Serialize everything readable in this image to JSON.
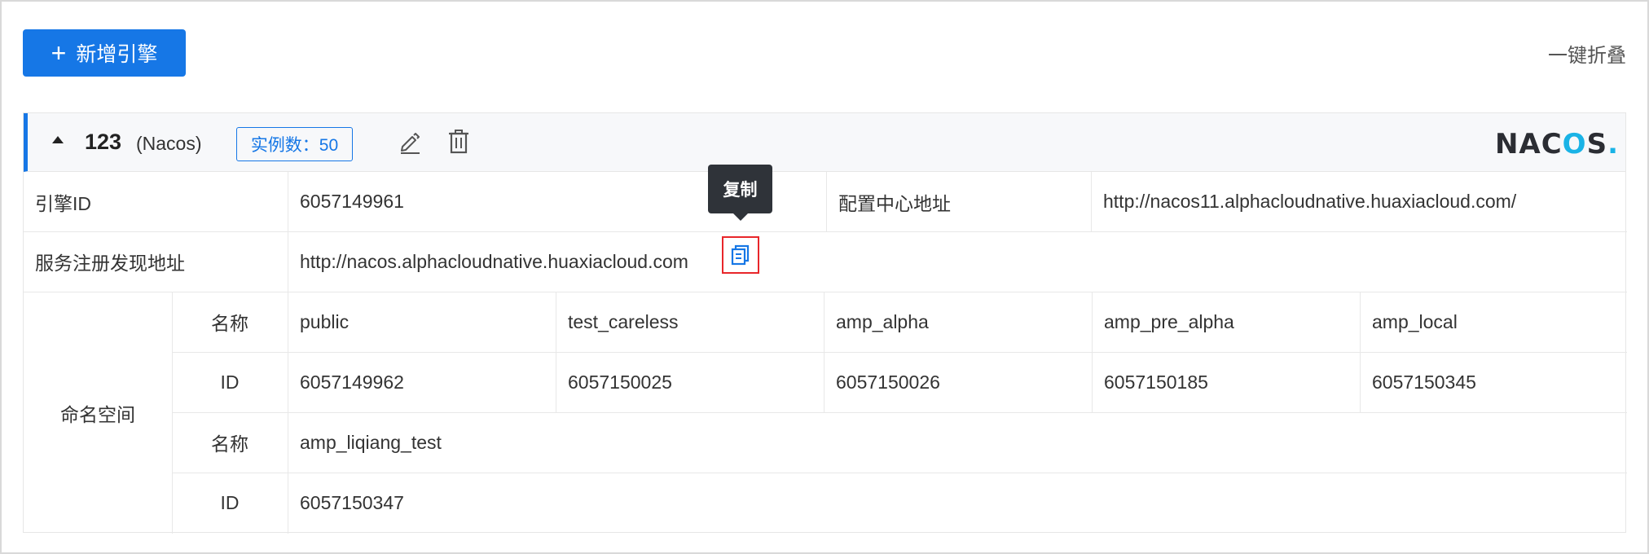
{
  "toolbar": {
    "add_label": "新增引擎",
    "collapse_all_label": "一键折叠"
  },
  "engine": {
    "name": "123",
    "type": "(Nacos)",
    "instance_badge": "实例数：50",
    "logo_text_pre": "NAC",
    "logo_text_o": "O",
    "logo_text_post": "S",
    "logo_dot": "."
  },
  "tooltip": {
    "copy": "复制"
  },
  "details": {
    "engine_id_label": "引擎ID",
    "engine_id_value": "6057149961",
    "config_center_label": "配置中心地址",
    "config_center_value": "http://nacos11.alphacloudnative.huaxiacloud.com/",
    "registry_label": "服务注册发现地址",
    "registry_value": "http://nacos.alphacloudnative.huaxiacloud.com"
  },
  "namespace": {
    "label": "命名空间",
    "name_label": "名称",
    "id_label": "ID",
    "row1_names": [
      "public",
      "test_careless",
      "amp_alpha",
      "amp_pre_alpha",
      "amp_local"
    ],
    "row1_ids": [
      "6057149962",
      "6057150025",
      "6057150026",
      "6057150185",
      "6057150345"
    ],
    "row2_names": [
      "amp_liqiang_test"
    ],
    "row2_ids": [
      "6057150347"
    ]
  },
  "colors": {
    "primary": "#1677e6",
    "highlight_border": "#e8262a",
    "tooltip_bg": "#2f3339",
    "nacos_accent": "#1ab3e6"
  },
  "icons": [
    "plus-icon",
    "caret-up-icon",
    "edit-icon",
    "delete-icon",
    "copy-icon",
    "nacos-logo"
  ]
}
